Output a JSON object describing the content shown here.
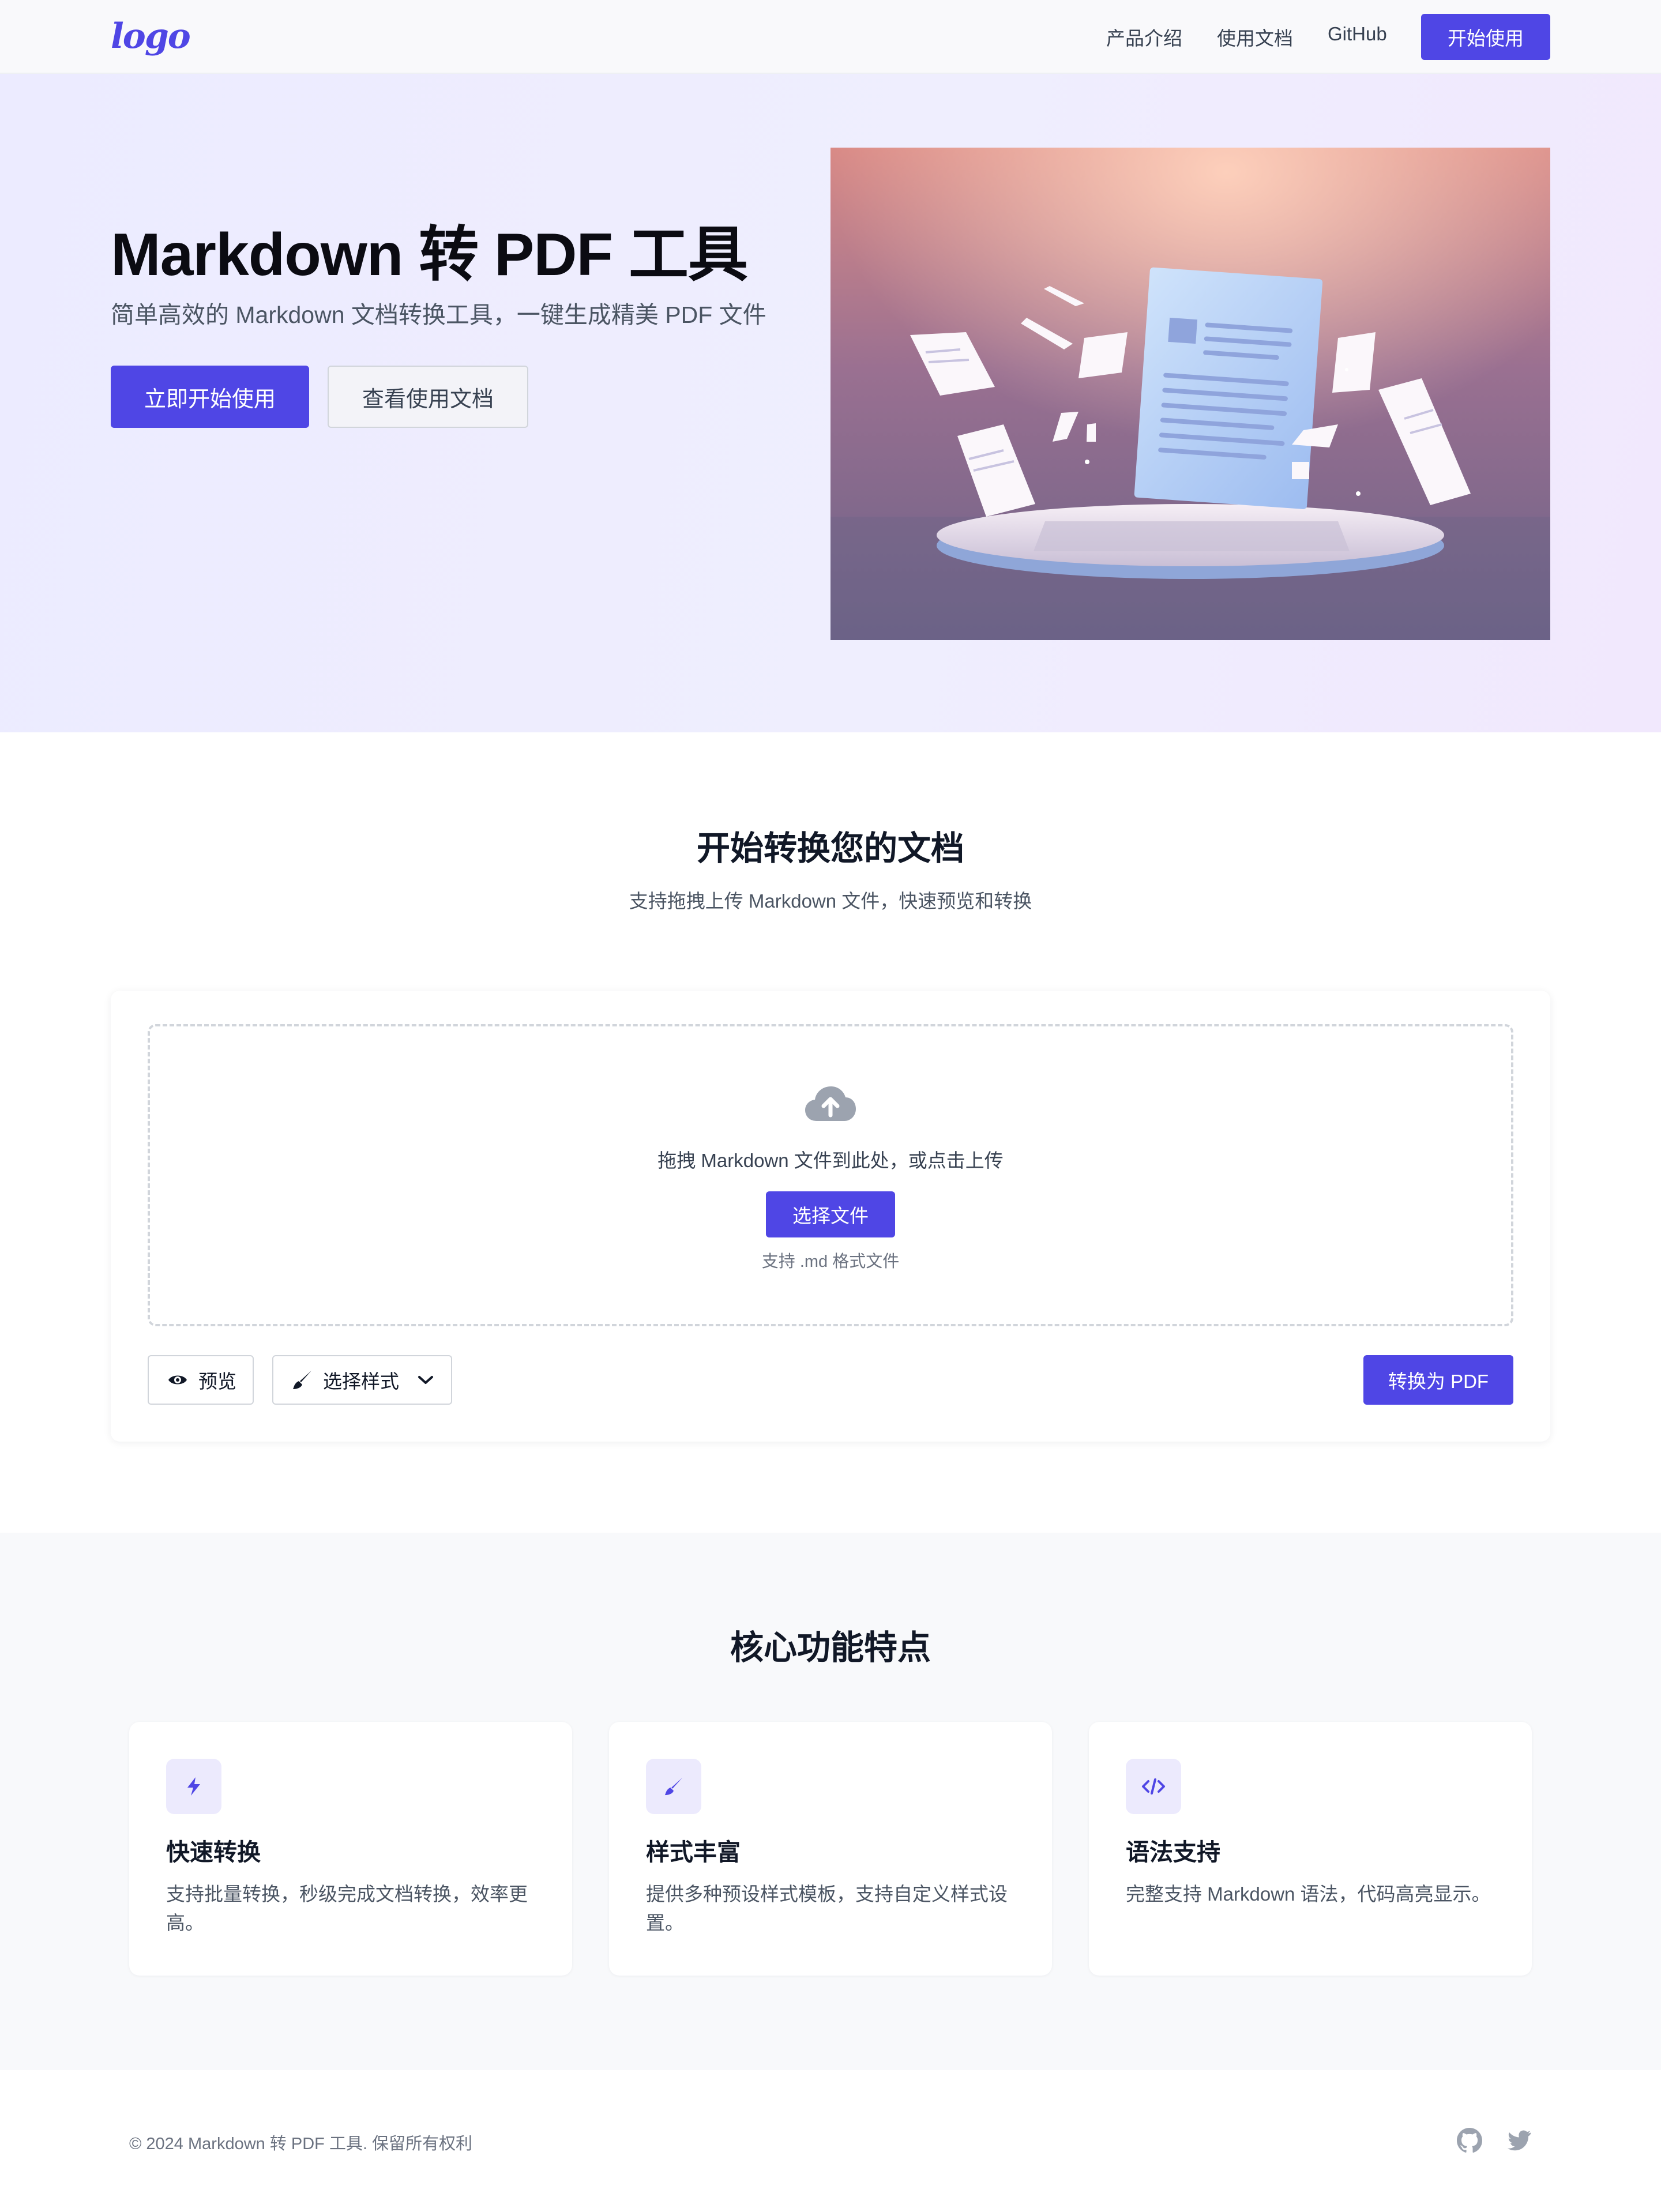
{
  "nav": {
    "logo": "logo",
    "links": [
      "产品介绍",
      "使用文档",
      "GitHub"
    ],
    "cta": "开始使用"
  },
  "hero": {
    "title": "Markdown 转 PDF 工具",
    "subtitle": "简单高效的 Markdown 文档转换工具，一键生成精美 PDF 文件",
    "primary_button": "立即开始使用",
    "secondary_button": "查看使用文档"
  },
  "convert": {
    "title": "开始转换您的文档",
    "subtitle": "支持拖拽上传 Markdown 文件，快速预览和转换",
    "drop_text": "拖拽 Markdown 文件到此处，或点击上传",
    "choose_button": "选择文件",
    "note": "支持 .md 格式文件",
    "preview_button": "预览",
    "style_select": "选择样式",
    "convert_button": "转换为 PDF"
  },
  "features": {
    "title": "核心功能特点",
    "items": [
      {
        "icon": "bolt-icon",
        "title": "快速转换",
        "desc": "支持批量转换，秒级完成文档转换，效率更高。"
      },
      {
        "icon": "brush-icon",
        "title": "样式丰富",
        "desc": "提供多种预设样式模板，支持自定义样式设置。"
      },
      {
        "icon": "code-icon",
        "title": "语法支持",
        "desc": "完整支持 Markdown 语法，代码高亮显示。"
      }
    ]
  },
  "footer": {
    "copyright": "© 2024 Markdown 转 PDF 工具. 保留所有权利",
    "icons": [
      "github-icon",
      "twitter-icon"
    ]
  },
  "colors": {
    "accent": "#4f46e5",
    "hero_bg": "#ecebff",
    "features_bg": "#f8f9fb"
  }
}
